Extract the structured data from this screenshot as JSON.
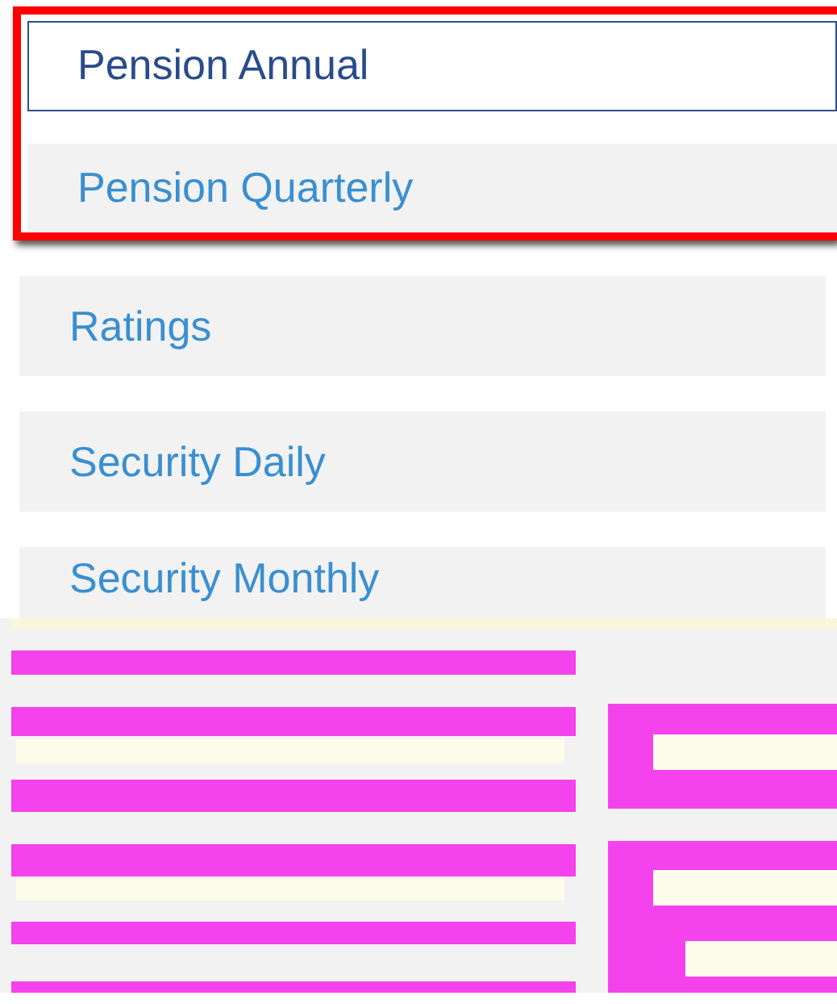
{
  "items": [
    {
      "label": "Pension Annual",
      "selected": true
    },
    {
      "label": "Pension Quarterly",
      "selected": false
    },
    {
      "label": "Ratings",
      "selected": false
    },
    {
      "label": "Security Daily",
      "selected": false
    },
    {
      "label": "Security Monthly",
      "selected": false
    }
  ]
}
